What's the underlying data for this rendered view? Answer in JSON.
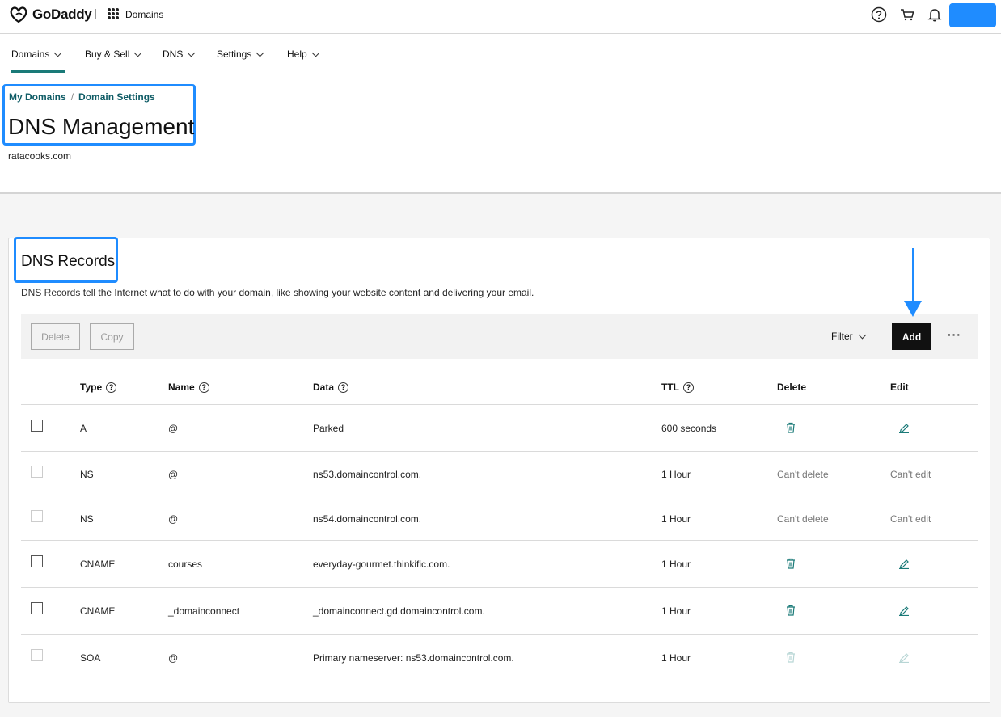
{
  "topbar": {
    "brand": "GoDaddy",
    "app_name": "Domains"
  },
  "nav": {
    "items": [
      {
        "label": "Domains"
      },
      {
        "label": "Buy & Sell"
      },
      {
        "label": "DNS"
      },
      {
        "label": "Settings"
      },
      {
        "label": "Help"
      }
    ]
  },
  "breadcrumb": {
    "items": [
      "My Domains",
      "Domain Settings"
    ],
    "separator": "/"
  },
  "page": {
    "title": "DNS Management",
    "domain": "ratacooks.com"
  },
  "records": {
    "title": "DNS Records",
    "desc_link": "DNS Records",
    "desc_rest": " tell the Internet what to do with your domain, like showing your website content and delivering your email."
  },
  "toolbar": {
    "delete_label": "Delete",
    "copy_label": "Copy",
    "filter_label": "Filter",
    "add_label": "Add",
    "more_label": "···"
  },
  "table": {
    "headers": {
      "type": "Type",
      "name": "Name",
      "data": "Data",
      "ttl": "TTL",
      "delete": "Delete",
      "edit": "Edit"
    },
    "rows": [
      {
        "type": "A",
        "name": "@",
        "data": "Parked",
        "ttl": "600 seconds",
        "deletable": true,
        "editable": true,
        "selectable": true
      },
      {
        "type": "NS",
        "name": "@",
        "data": "ns53.domaincontrol.com.",
        "ttl": "1 Hour",
        "delete_text": "Can't delete",
        "edit_text": "Can't edit",
        "deletable": false,
        "editable": false,
        "selectable": false
      },
      {
        "type": "NS",
        "name": "@",
        "data": "ns54.domaincontrol.com.",
        "ttl": "1 Hour",
        "delete_text": "Can't delete",
        "edit_text": "Can't edit",
        "deletable": false,
        "editable": false,
        "selectable": false
      },
      {
        "type": "CNAME",
        "name": "courses",
        "data": "everyday-gourmet.thinkific.com.",
        "ttl": "1 Hour",
        "deletable": true,
        "editable": true,
        "selectable": true
      },
      {
        "type": "CNAME",
        "name": "_domainconnect",
        "data": "_domainconnect.gd.domaincontrol.com.",
        "ttl": "1 Hour",
        "deletable": true,
        "editable": true,
        "selectable": true
      },
      {
        "type": "SOA",
        "name": "@",
        "data": "Primary nameserver: ns53.domaincontrol.com.",
        "ttl": "1 Hour",
        "deletable": false,
        "editable": false,
        "selectable": false,
        "icons_disabled": true
      }
    ]
  },
  "colors": {
    "accent": "#1a7a78",
    "highlight": "#1f8cff",
    "link": "#0f5c66"
  }
}
